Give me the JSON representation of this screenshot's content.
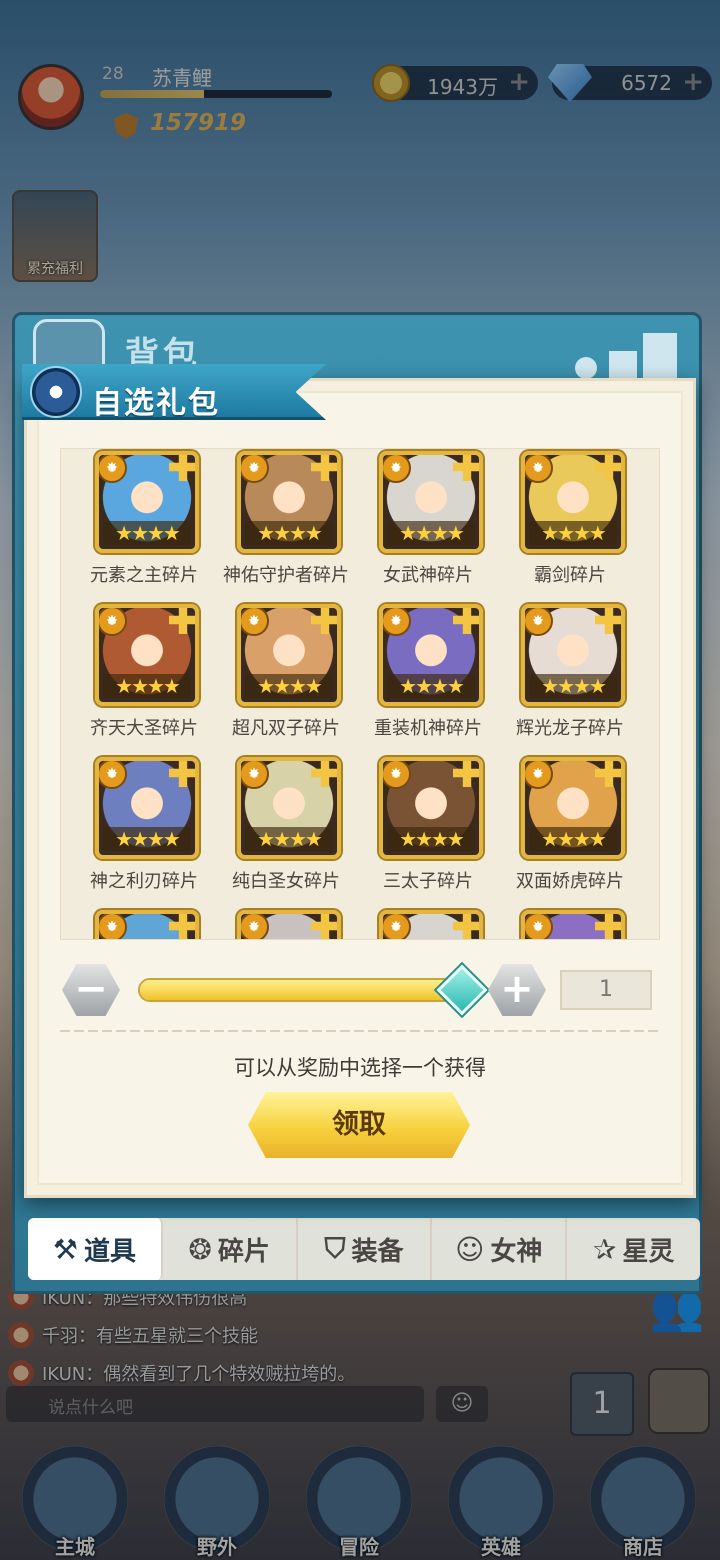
{
  "hud": {
    "level": "28",
    "player_name": "苏青鲤",
    "exp_fraction": 0.45,
    "power": "157919",
    "gold": "1943万",
    "gems": "6572",
    "plus": "+"
  },
  "welfare_label": "累充福利",
  "backpack": {
    "title": "背包",
    "tabs": [
      {
        "label": "道具",
        "icon": "item-icon",
        "glyph": "⚒"
      },
      {
        "label": "碎片",
        "icon": "fragment-icon",
        "glyph": "❂"
      },
      {
        "label": "装备",
        "icon": "equipment-icon",
        "glyph": "⛉"
      },
      {
        "label": "女神",
        "icon": "goddess-icon",
        "glyph": "☺"
      },
      {
        "label": "星灵",
        "icon": "star-spirit-icon",
        "glyph": "✰"
      }
    ]
  },
  "gift_dialog": {
    "title": "自选礼包",
    "items": [
      {
        "name": "元素之主碎片",
        "stars": "★★★★",
        "color": "#5aa7e0"
      },
      {
        "name": "神佑守护者碎片",
        "stars": "★★★★",
        "color": "#b88a5a"
      },
      {
        "name": "女武神碎片",
        "stars": "★★★★",
        "color": "#d9d6d0"
      },
      {
        "name": "霸剑碎片",
        "stars": "★★★★",
        "color": "#e8c95a"
      },
      {
        "name": "齐天大圣碎片",
        "stars": "★★★★",
        "color": "#b05a33"
      },
      {
        "name": "超凡双子碎片",
        "stars": "★★★★",
        "color": "#d9a06a"
      },
      {
        "name": "重装机神碎片",
        "stars": "★★★★",
        "color": "#7a6cc0"
      },
      {
        "name": "辉光龙子碎片",
        "stars": "★★★★",
        "color": "#e6dcd4"
      },
      {
        "name": "神之利刃碎片",
        "stars": "★★★★",
        "color": "#6d7fbf"
      },
      {
        "name": "纯白圣女碎片",
        "stars": "★★★★",
        "color": "#d8d2a8"
      },
      {
        "name": "三太子碎片",
        "stars": "★★★★",
        "color": "#7a5234"
      },
      {
        "name": "双面娇虎碎片",
        "stars": "★★★★",
        "color": "#e0a24a"
      },
      {
        "name": "",
        "stars": "",
        "color": "#5fa6d6"
      },
      {
        "name": "",
        "stars": "",
        "color": "#c9c0c0"
      },
      {
        "name": "",
        "stars": "",
        "color": "#d8d4cf"
      },
      {
        "name": "",
        "stars": "",
        "color": "#8a6fc2"
      }
    ],
    "quantity": "1",
    "slider_fraction": 1.0,
    "minus": "−",
    "plus": "+",
    "hint": "可以从奖励中选择一个获得",
    "claim_label": "领取"
  },
  "chat": {
    "lines": [
      "IKUN：那些特效伟伤很高",
      "千羽：有些五星就三个技能",
      "IKUN：偶然看到了几个特效贼拉垮的。"
    ],
    "placeholder": "说点什么吧",
    "emoji_glyph": "☺"
  },
  "bottom_nav": [
    {
      "label": "主城",
      "icon": "main-city-icon"
    },
    {
      "label": "野外",
      "icon": "wild-icon"
    },
    {
      "label": "冒险",
      "icon": "adventure-icon"
    },
    {
      "label": "英雄",
      "icon": "hero-icon"
    },
    {
      "label": "商店",
      "icon": "shop-icon"
    }
  ]
}
